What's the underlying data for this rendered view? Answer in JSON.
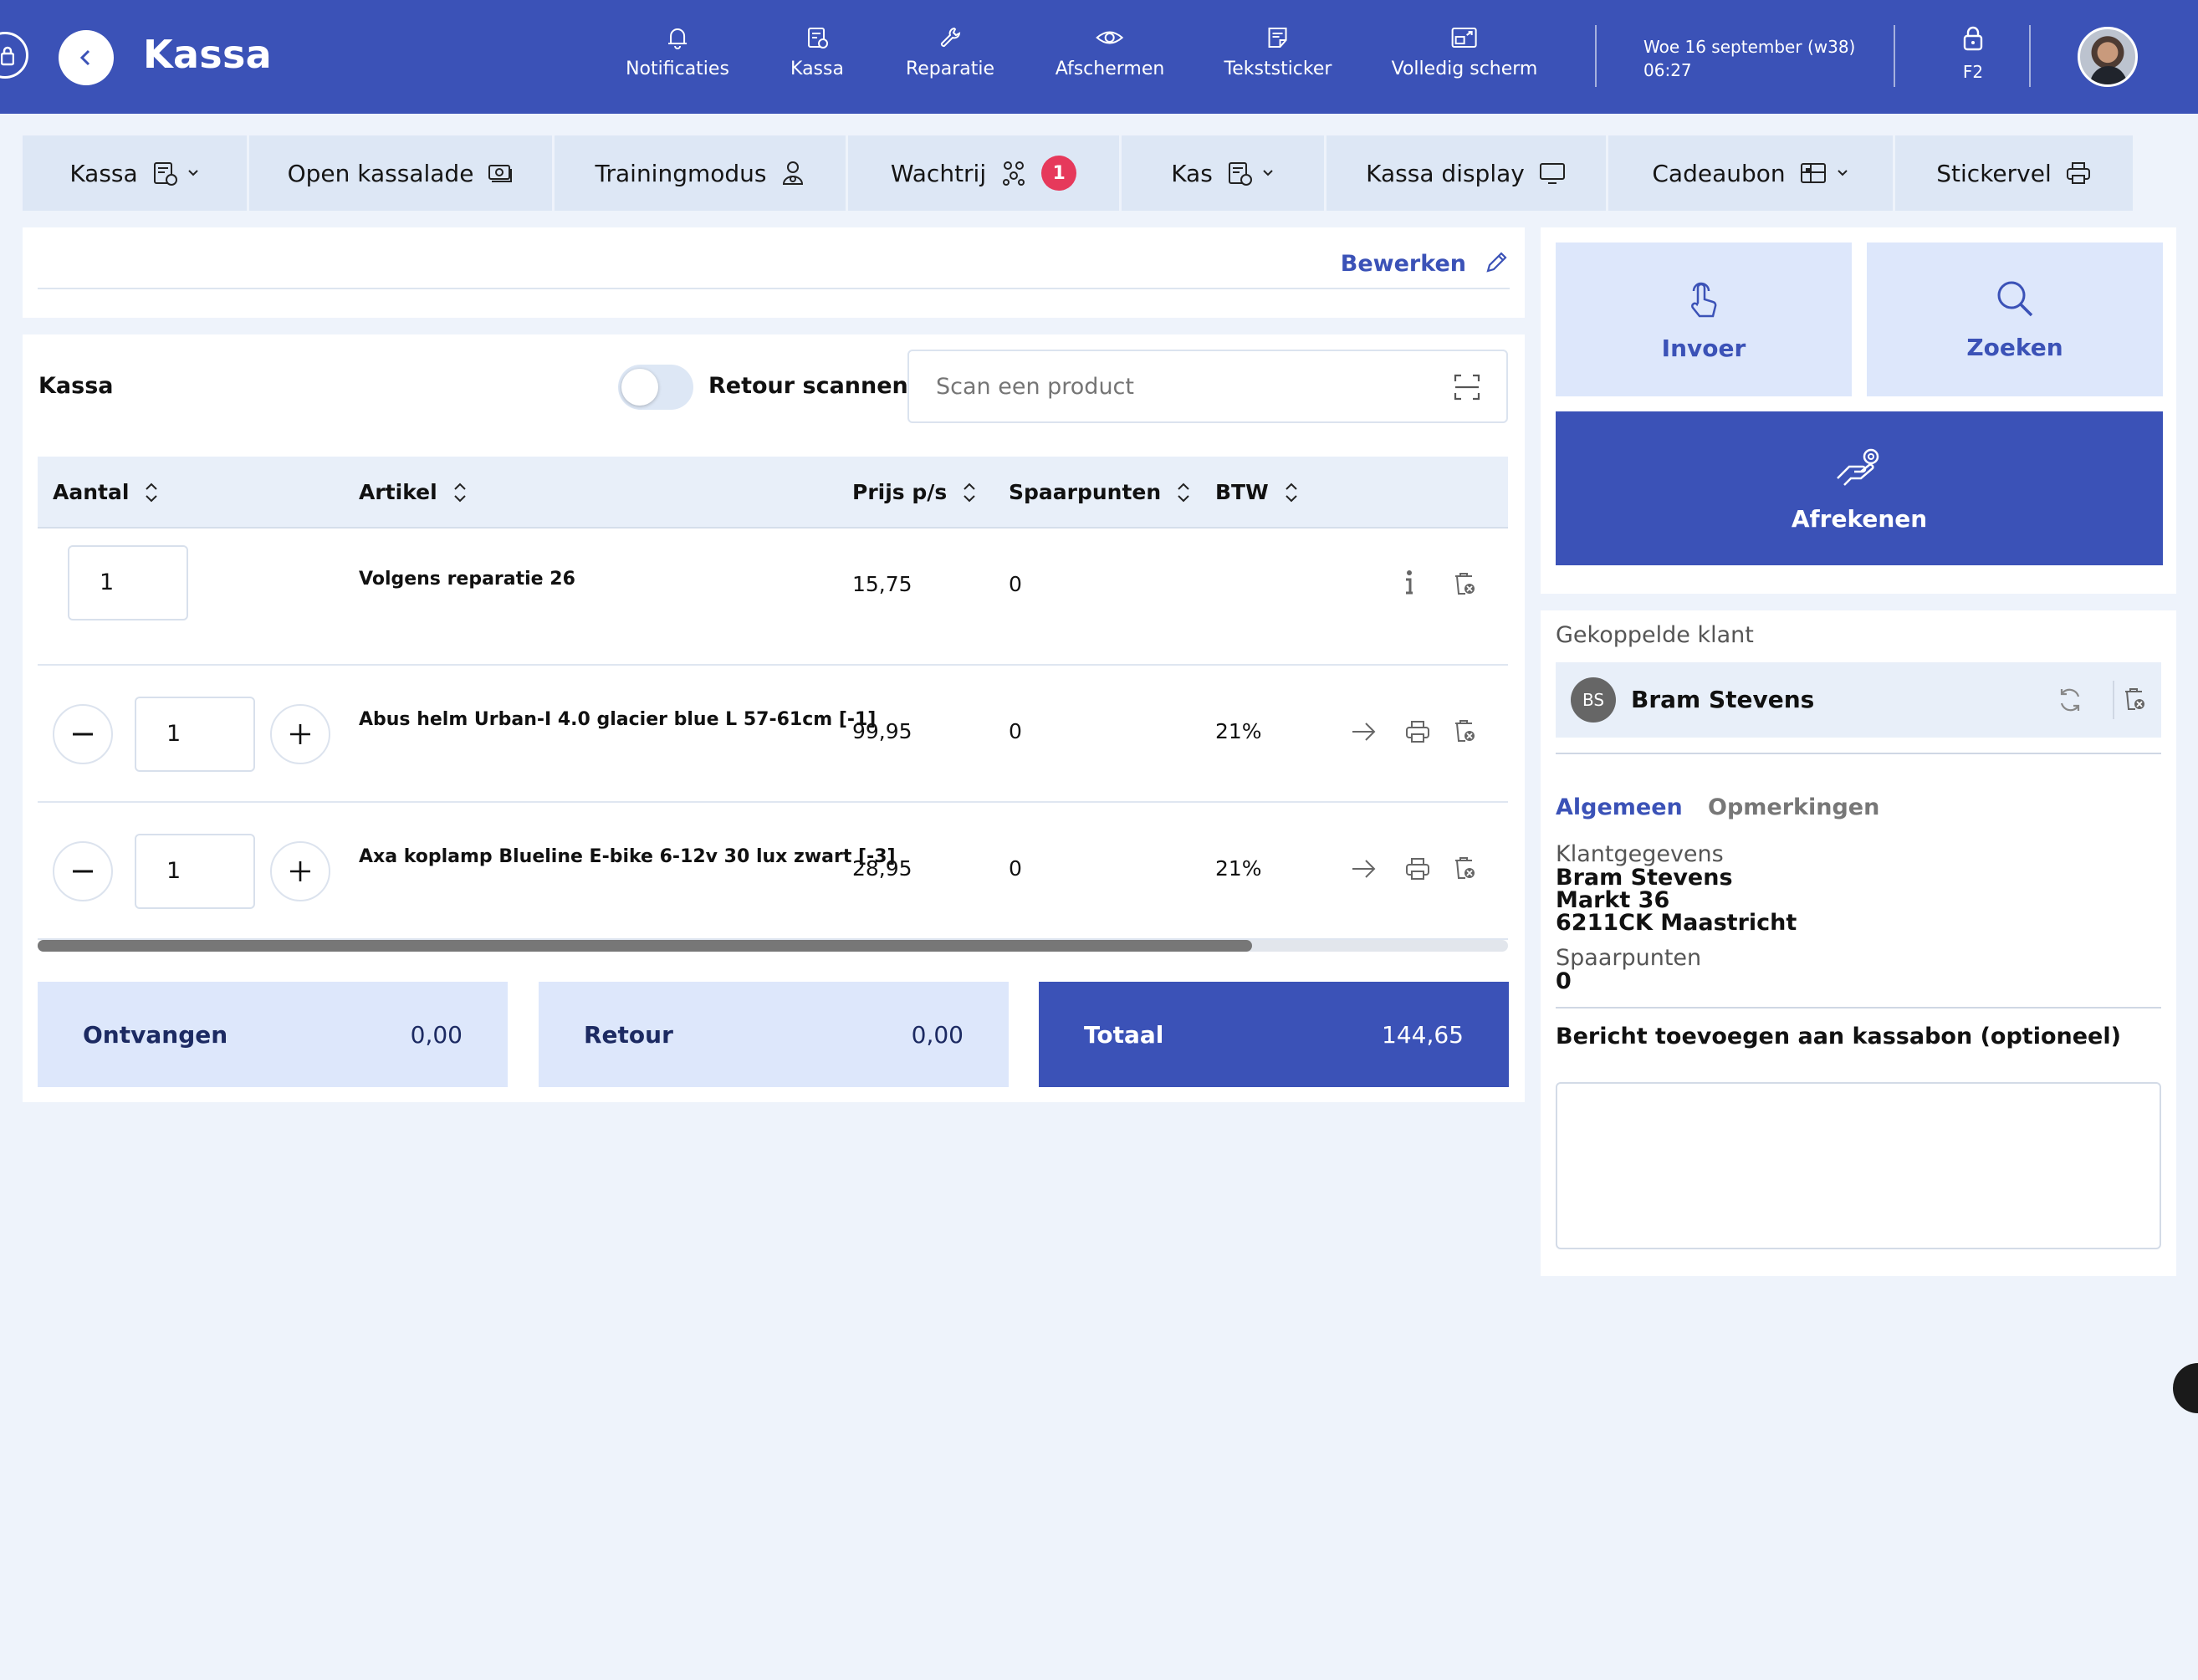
{
  "app": {
    "title": "Kassa",
    "datetime_line1": "Woe 16 september (w38)",
    "datetime_line2": "06:27",
    "lock_shortcut": "F2"
  },
  "topnav": [
    {
      "label": "Notificaties",
      "icon": "bell-icon"
    },
    {
      "label": "Kassa",
      "icon": "register-icon"
    },
    {
      "label": "Reparatie",
      "icon": "wrench-icon"
    },
    {
      "label": "Afschermen",
      "icon": "eye-icon"
    },
    {
      "label": "Tekststicker",
      "icon": "note-icon"
    },
    {
      "label": "Volledig scherm",
      "icon": "fullscreen-icon"
    }
  ],
  "toolbar": [
    {
      "label": "Kassa",
      "icon": "register-icon",
      "dropdown": true
    },
    {
      "label": "Open kassalade",
      "icon": "cash-drawer-icon"
    },
    {
      "label": "Trainingmodus",
      "icon": "trainer-icon"
    },
    {
      "label": "Wachtrij",
      "icon": "queue-icon",
      "badge": "1"
    },
    {
      "label": "Kas",
      "icon": "register-icon",
      "dropdown": true
    },
    {
      "label": "Kassa display",
      "icon": "monitor-icon"
    },
    {
      "label": "Cadeaubon",
      "icon": "gift-card-icon",
      "dropdown": true
    },
    {
      "label": "Stickervel",
      "icon": "printer-icon"
    }
  ],
  "edit": {
    "label": "Bewerken"
  },
  "kassa": {
    "label": "Kassa",
    "retour_label": "Retour scannen",
    "retour_enabled": false,
    "scan_placeholder": "Scan een product"
  },
  "table": {
    "columns": [
      "Aantal",
      "Artikel",
      "Prijs p/s",
      "Spaarpunten",
      "BTW"
    ],
    "rows": [
      {
        "qty": "1",
        "article": "Volgens reparatie 26",
        "price": "15,75",
        "points": "0",
        "vat": "",
        "steppers": false,
        "actions": [
          "info",
          "delete"
        ]
      },
      {
        "qty": "1",
        "article": "Abus helm Urban-I 4.0 glacier blue L 57-61cm [-1]",
        "price": "99,95",
        "points": "0",
        "vat": "21%",
        "steppers": true,
        "actions": [
          "arrow",
          "print",
          "delete"
        ]
      },
      {
        "qty": "1",
        "article": "Axa koplamp Blueline E-bike 6-12v 30 lux zwart [-3]",
        "price": "28,95",
        "points": "0",
        "vat": "21%",
        "steppers": true,
        "actions": [
          "arrow",
          "print",
          "delete"
        ]
      }
    ]
  },
  "totals": {
    "received_label": "Ontvangen",
    "received_value": "0,00",
    "return_label": "Retour",
    "return_value": "0,00",
    "total_label": "Totaal",
    "total_value": "144,65"
  },
  "actions": {
    "input_label": "Invoer",
    "search_label": "Zoeken",
    "checkout_label": "Afrekenen"
  },
  "customer": {
    "section_title": "Gekoppelde klant",
    "initials": "BS",
    "name": "Bram Stevens",
    "tabs": [
      "Algemeen",
      "Opmerkingen"
    ],
    "details_label": "Klantgegevens",
    "details_name": "Bram Stevens",
    "address_line1": "Markt 36",
    "address_line2": "6211CK Maastricht",
    "points_label": "Spaarpunten",
    "points_value": "0",
    "message_label": "Bericht toevoegen aan kassabon (optioneel)"
  },
  "colors": {
    "primary": "#3b52b7",
    "light_panel": "#dde7fb",
    "badge": "#e6395b",
    "background": "#eef3fb"
  }
}
